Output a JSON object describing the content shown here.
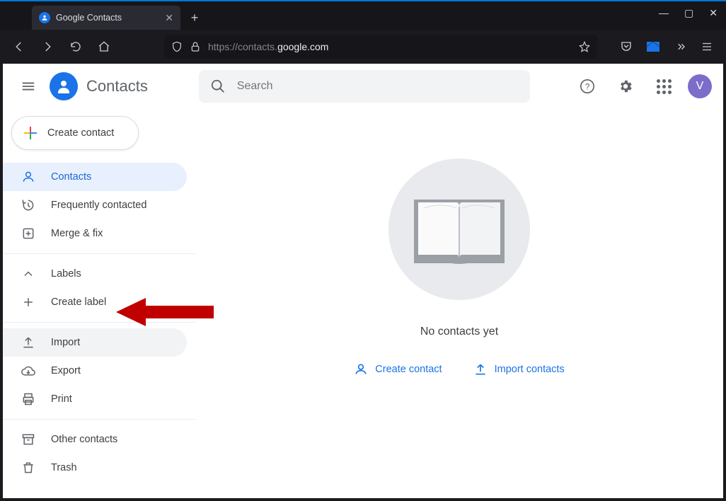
{
  "browser": {
    "tab_title": "Google Contacts",
    "url_prefix": "https://contacts.",
    "url_host": "google.com",
    "url_suffix": ""
  },
  "header": {
    "app_title": "Contacts",
    "search_placeholder": "Search",
    "avatar_initial": "V"
  },
  "sidebar": {
    "create_label": "Create contact",
    "items": [
      {
        "label": "Contacts"
      },
      {
        "label": "Frequently contacted"
      },
      {
        "label": "Merge & fix"
      }
    ],
    "labels_header": "Labels",
    "create_label_label": "Create label",
    "import_label": "Import",
    "export_label": "Export",
    "print_label": "Print",
    "other_label": "Other contacts",
    "trash_label": "Trash"
  },
  "main": {
    "empty_message": "No contacts yet",
    "create_action": "Create contact",
    "import_action": "Import contacts"
  }
}
